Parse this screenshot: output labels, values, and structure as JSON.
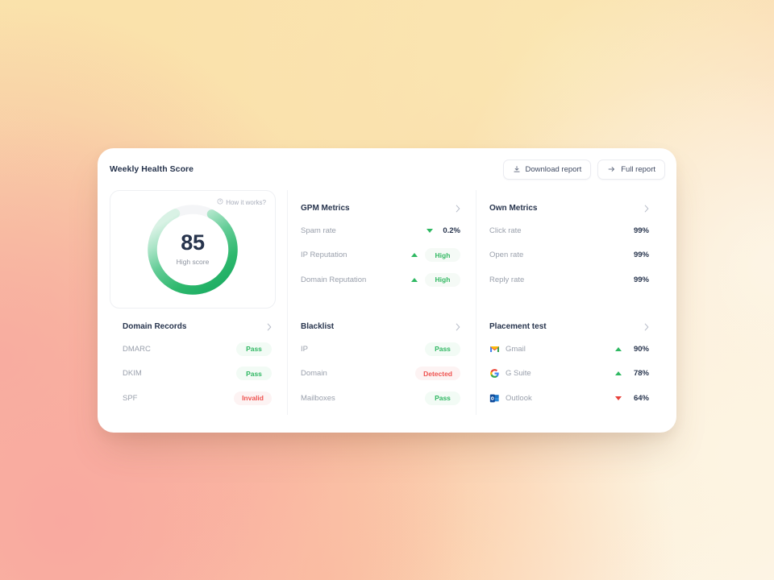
{
  "header": {
    "title": "Weekly Health Score",
    "buttons": [
      {
        "label": "Download report",
        "icon": "download-icon"
      },
      {
        "label": "Full report",
        "icon": "arrow-right-icon"
      }
    ]
  },
  "score_panel": {
    "how_it_works": "How it works?",
    "how_it_works_icon": "info-circle-icon",
    "score": "85",
    "subtitle": "High score",
    "percent": 85,
    "ring_color_start": "#19ab63",
    "ring_color_end": "#d8f2e4",
    "track_color": "#f4f5f7"
  },
  "panels": {
    "gpm_metrics": {
      "title": "GPM Metrics",
      "chevron": "chevron-right-icon",
      "rows": [
        {
          "label": "Spam rate",
          "trend": "down",
          "trend_color": "#2fb862",
          "value": "0.2%",
          "type": "value"
        },
        {
          "label": "IP Reputation",
          "trend": "up",
          "trend_color": "#2fb862",
          "value": "High",
          "type": "badge",
          "badge_style": "pale"
        },
        {
          "label": "Domain Reputation",
          "trend": "up",
          "trend_color": "#2fb862",
          "value": "High",
          "type": "badge",
          "badge_style": "pale"
        }
      ]
    },
    "own_metrics": {
      "title": "Own Metrics",
      "chevron": "chevron-right-icon",
      "rows": [
        {
          "label": "Click rate",
          "value": "99%",
          "type": "value"
        },
        {
          "label": "Open rate",
          "value": "99%",
          "type": "value"
        },
        {
          "label": "Reply rate",
          "value": "99%",
          "type": "value"
        }
      ]
    },
    "domain_records": {
      "title": "Domain Records",
      "chevron": "chevron-right-icon",
      "rows": [
        {
          "label": "DMARC",
          "value": "Pass",
          "type": "badge",
          "badge_style": "green"
        },
        {
          "label": "DKIM",
          "value": "Pass",
          "type": "badge",
          "badge_style": "green"
        },
        {
          "label": "SPF",
          "value": "Invalid",
          "type": "badge",
          "badge_style": "red"
        }
      ]
    },
    "blacklist": {
      "title": "Blacklist",
      "chevron": "chevron-right-icon",
      "rows": [
        {
          "label": "IP",
          "value": "Pass",
          "type": "badge",
          "badge_style": "green"
        },
        {
          "label": "Domain",
          "value": "Detected",
          "type": "badge",
          "badge_style": "red"
        },
        {
          "label": "Mailboxes",
          "value": "Pass",
          "type": "badge",
          "badge_style": "green"
        }
      ]
    },
    "placement_test": {
      "title": "Placement test",
      "chevron": "chevron-right-icon",
      "rows": [
        {
          "label": "Gmail",
          "icon": "gmail-icon",
          "trend": "up",
          "trend_color": "#2fb862",
          "value": "90%",
          "type": "value"
        },
        {
          "label": "G Suite",
          "icon": "google-icon",
          "trend": "up",
          "trend_color": "#2fb862",
          "value": "78%",
          "type": "value"
        },
        {
          "label": "Outlook",
          "icon": "outlook-icon",
          "trend": "down",
          "trend_color": "#e8403a",
          "value": "64%",
          "type": "value"
        }
      ]
    }
  },
  "theme": {
    "accent_green": "#2fb862",
    "danger_red": "#e8403a",
    "text_dark": "#27344d",
    "text_muted": "#9aa0ac",
    "card_bg": "#ffffff"
  }
}
